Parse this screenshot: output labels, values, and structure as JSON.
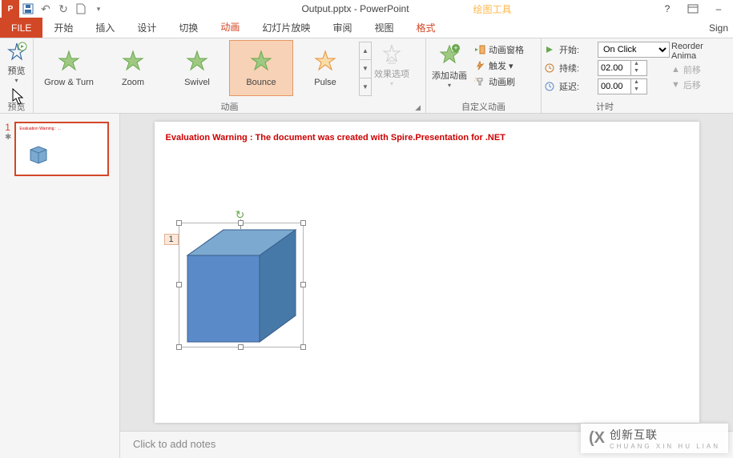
{
  "title_bar": {
    "document_title": "Output.pptx - PowerPoint",
    "contextual_tab_title": "绘图工具"
  },
  "qat_icons": {
    "app": "P",
    "save": "💾",
    "undo": "↶",
    "redo": "↻",
    "new": "▢",
    "customize": "▾"
  },
  "title_right": {
    "help": "?",
    "fullscreen": "▣",
    "minimize": "–"
  },
  "tabs": {
    "file": "FILE",
    "home": "开始",
    "insert": "插入",
    "design": "设计",
    "transitions": "切换",
    "animations": "动画",
    "slideshow": "幻灯片放映",
    "review": "审阅",
    "view": "视图",
    "format": "格式",
    "signin": "Sign"
  },
  "groups": {
    "preview": {
      "button": "预览",
      "label": "预览"
    },
    "animation": {
      "items": [
        {
          "label": "Grow & Turn"
        },
        {
          "label": "Zoom"
        },
        {
          "label": "Swivel"
        },
        {
          "label": "Bounce"
        },
        {
          "label": "Pulse"
        }
      ],
      "effect_options": "效果选项",
      "label": "动画"
    },
    "advanced": {
      "add_animation": "添加动画",
      "pane": "动画窗格",
      "trigger": "触发 ▾",
      "painter": "动画刷",
      "label": "自定义动画"
    },
    "timing": {
      "start_label": "开始:",
      "start_value": "On Click",
      "duration_label": "持续:",
      "duration_value": "02.00",
      "delay_label": "延迟:",
      "delay_value": "00.00",
      "label": "计时"
    },
    "reorder": {
      "header": "Reorder Anima",
      "earlier": "前移",
      "later": "后移"
    }
  },
  "thumbnails": {
    "slide1_number": "1",
    "anim_indicator": "✱"
  },
  "slide": {
    "eval_warning": "Evaluation Warning : The document was created with  Spire.Presentation for .NET",
    "shape_tag": "1"
  },
  "notes": {
    "placeholder": "Click to add notes"
  },
  "watermark": {
    "logo": "(X",
    "text": "创新互联",
    "sub": "CHUANG XIN HU LIAN"
  }
}
